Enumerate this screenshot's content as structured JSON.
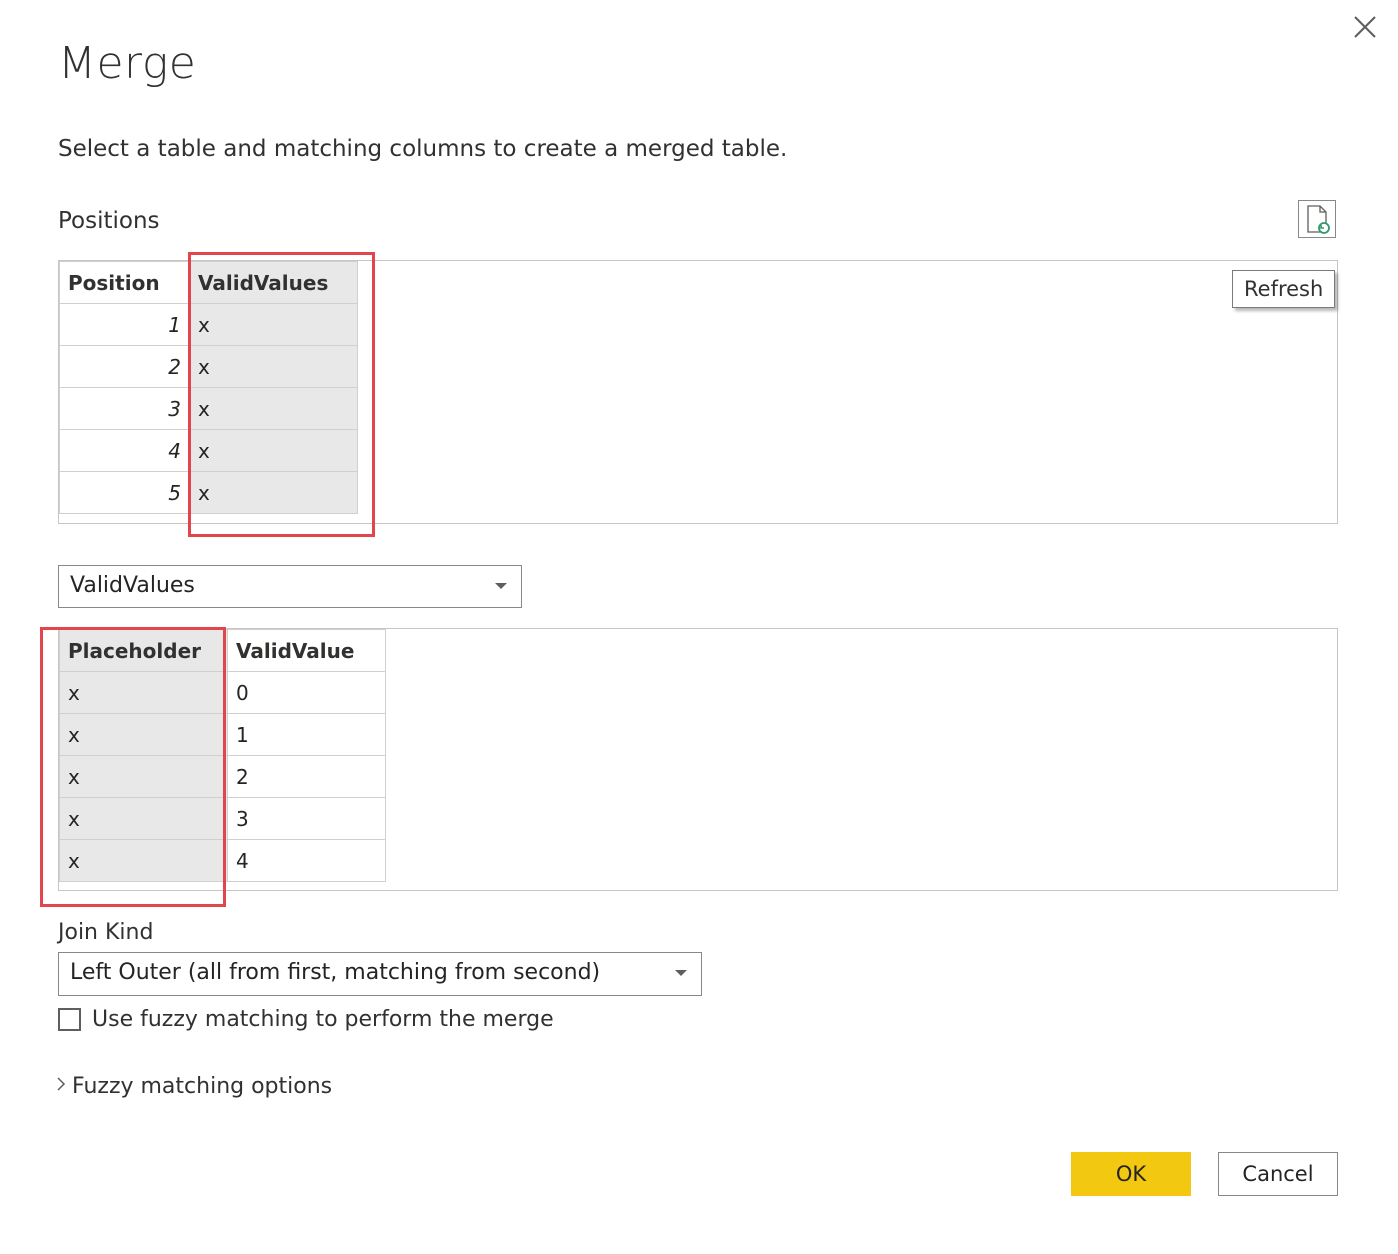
{
  "dialog": {
    "title": "Merge",
    "subtitle": "Select a table and matching columns to create a merged table."
  },
  "first_table": {
    "name": "Positions",
    "refresh_tooltip": "Refresh",
    "columns": [
      "Position",
      "ValidValues"
    ],
    "selected_column": "ValidValues",
    "rows": [
      [
        "1",
        "x"
      ],
      [
        "2",
        "x"
      ],
      [
        "3",
        "x"
      ],
      [
        "4",
        "x"
      ],
      [
        "5",
        "x"
      ]
    ]
  },
  "second_table": {
    "selected": "ValidValues",
    "columns": [
      "Placeholder",
      "ValidValue"
    ],
    "selected_column": "Placeholder",
    "rows": [
      [
        "x",
        "0"
      ],
      [
        "x",
        "1"
      ],
      [
        "x",
        "2"
      ],
      [
        "x",
        "3"
      ],
      [
        "x",
        "4"
      ]
    ]
  },
  "join": {
    "label": "Join Kind",
    "selected": "Left Outer (all from first, matching from second)"
  },
  "fuzzy": {
    "checkbox_label": "Use fuzzy matching to perform the merge",
    "checked": false,
    "options_label": "Fuzzy matching options"
  },
  "buttons": {
    "ok": "OK",
    "cancel": "Cancel"
  },
  "colors": {
    "ok_accent": "#f2c811",
    "highlight_box": "#e0464c",
    "selected_column_bg": "#e8e8e8"
  }
}
